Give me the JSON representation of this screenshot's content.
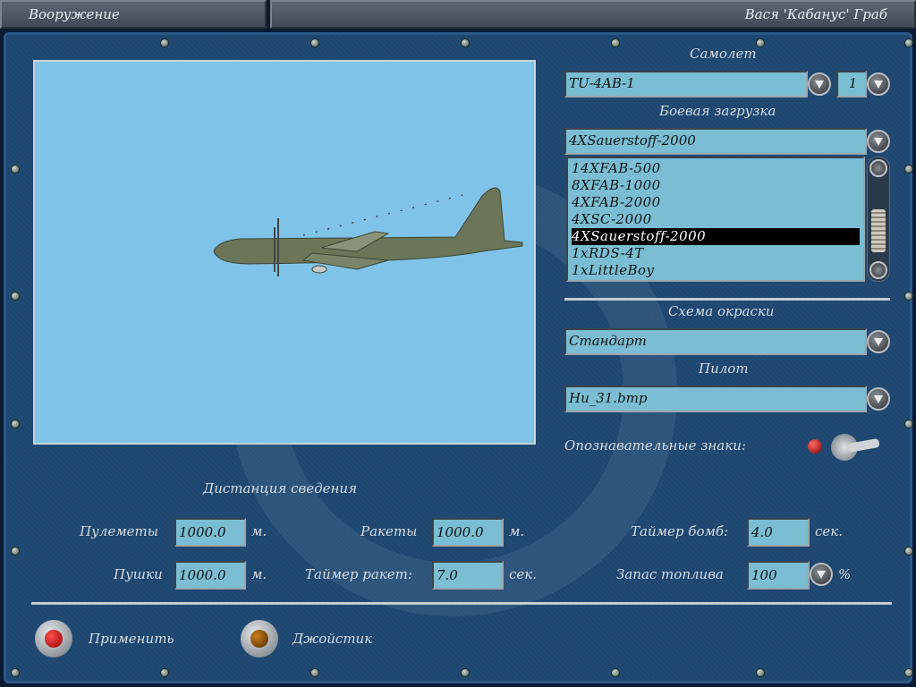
{
  "title": {
    "left": "Вооружение",
    "right": "Вася 'Кабанус' Граб"
  },
  "aircraft": {
    "label": "Самолет",
    "value": "TU-4AB-1",
    "count": "1"
  },
  "loadout": {
    "label": "Боевая загрузка",
    "value": "4XSauerstoff-2000",
    "options": [
      "14XFAB-500",
      "8XFAB-1000",
      "4XFAB-2000",
      "4XSC-2000",
      "4XSauerstoff-2000",
      "1xRDS-4T",
      "1xLittleBoy"
    ],
    "selected_index": 4
  },
  "paint": {
    "label": "Схема окраски",
    "value": "Стандарт"
  },
  "pilot": {
    "label": "Пилот",
    "value": "Hu_31.bmp"
  },
  "markings": {
    "label": "Опознавательные знаки:"
  },
  "convergence": {
    "label": "Дистанция сведения",
    "mg": {
      "label": "Пулеметы",
      "value": "1000.0",
      "unit": "м."
    },
    "cannon": {
      "label": "Пушки",
      "value": "1000.0",
      "unit": "м."
    },
    "rockets": {
      "label": "Ракеты",
      "value": "1000.0",
      "unit": "м."
    },
    "rocket_timer": {
      "label": "Таймер ракет:",
      "value": "7.0",
      "unit": "сек."
    },
    "bomb_timer": {
      "label": "Таймер бомб:",
      "value": "4.0",
      "unit": "сек."
    },
    "fuel": {
      "label": "Запас топлива",
      "value": "100",
      "unit": "%"
    }
  },
  "buttons": {
    "apply": "Применить",
    "joystick": "Джойстик"
  }
}
